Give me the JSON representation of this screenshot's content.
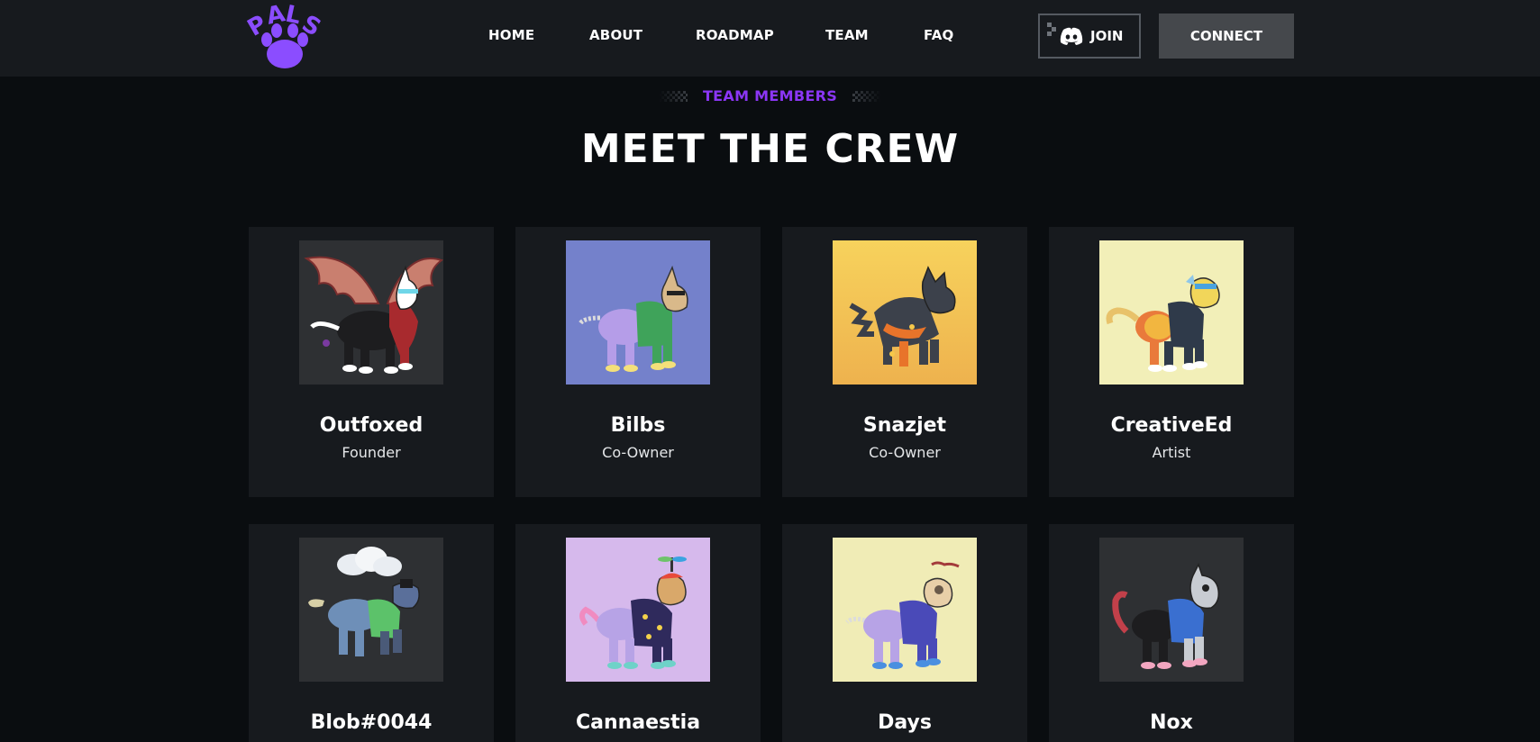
{
  "brand": {
    "logo_text": "PALS",
    "logo_letters": [
      "P",
      "A",
      "L",
      "S"
    ],
    "accent_color": "#8b4dff"
  },
  "nav": {
    "items": [
      {
        "label": "HOME"
      },
      {
        "label": "ABOUT"
      },
      {
        "label": "ROADMAP"
      },
      {
        "label": "TEAM"
      },
      {
        "label": "FAQ"
      }
    ],
    "join_label": "JOIN",
    "join_icon": "discord-icon",
    "connect_label": "CONNECT"
  },
  "section": {
    "eyebrow": "TEAM MEMBERS",
    "eyebrow_color": "#8b36f5",
    "title": "MEET THE CREW"
  },
  "team": [
    {
      "name": "Outfoxed",
      "role": "Founder",
      "bg": "#2e3033"
    },
    {
      "name": "Bilbs",
      "role": "Co-Owner",
      "bg": "#7481cb"
    },
    {
      "name": "Snazjet",
      "role": "Co-Owner",
      "bg": "#f3bf55"
    },
    {
      "name": "CreativeEd",
      "role": "Artist",
      "bg": "#f2efb8"
    },
    {
      "name": "Blob#0044",
      "role": "",
      "bg": "#2e3033"
    },
    {
      "name": "Cannaestia",
      "role": "",
      "bg": "#d6b9ec"
    },
    {
      "name": "Days",
      "role": "",
      "bg": "#f0ecb6"
    },
    {
      "name": "Nox",
      "role": "",
      "bg": "#2e3033"
    }
  ]
}
